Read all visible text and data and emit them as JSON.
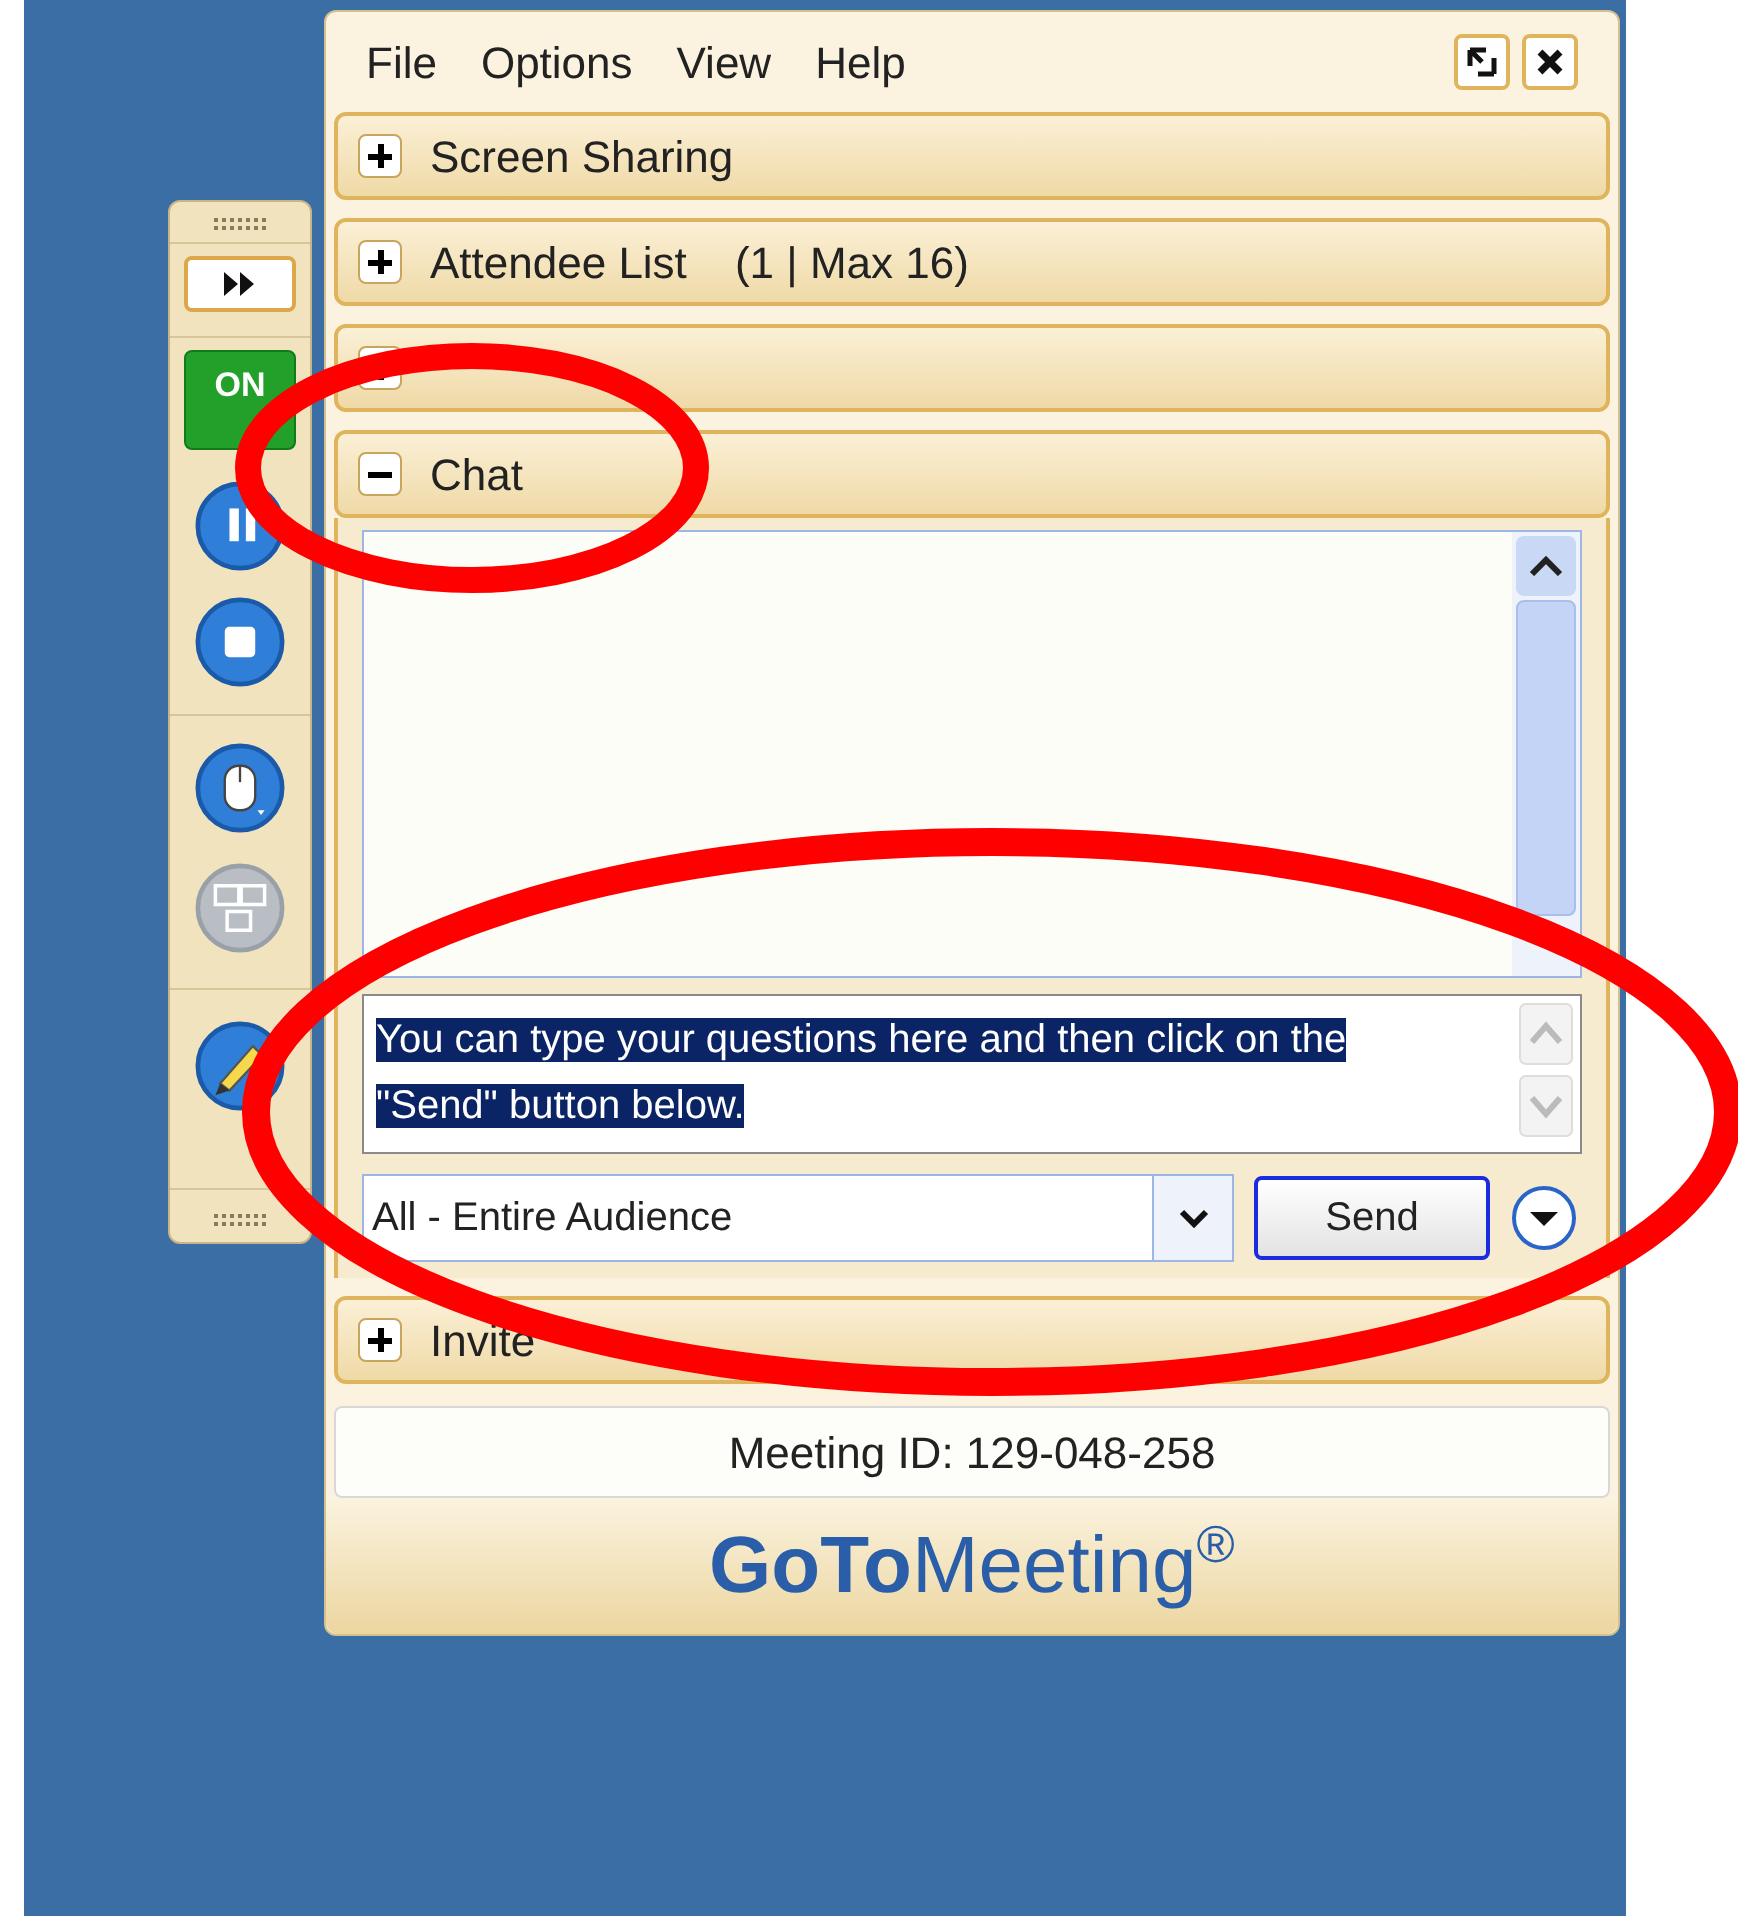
{
  "menu": [
    {
      "label": "File"
    },
    {
      "label": "Options"
    },
    {
      "label": "View"
    },
    {
      "label": "Help"
    }
  ],
  "sections": [
    {
      "label": "Screen Sharing",
      "expanded": false
    },
    {
      "label": "Attendee List",
      "count": "(1 | Max 16)",
      "expanded": false
    },
    {
      "expanded": false
    },
    {
      "label": "Chat",
      "expanded": true
    },
    {
      "label": "Invite",
      "expanded": false
    }
  ],
  "chat": {
    "message": "You can type your questions here and then click on the \"Send\" button below.",
    "recipient": "All - Entire Audience",
    "send": "Send"
  },
  "meeting_id": "Meeting ID: 129-048-258",
  "logo": {
    "bold": "GoTo",
    "rest": "Meeting",
    "mark": "®"
  },
  "toolbar": {
    "on_air": "ON",
    "tools": [
      {
        "kind": "pause",
        "disabled": false
      },
      {
        "kind": "stop",
        "disabled": false
      },
      {
        "kind": "mouse",
        "disabled": false
      },
      {
        "kind": "screens",
        "disabled": true
      },
      {
        "kind": "pen",
        "disabled": false
      }
    ]
  }
}
